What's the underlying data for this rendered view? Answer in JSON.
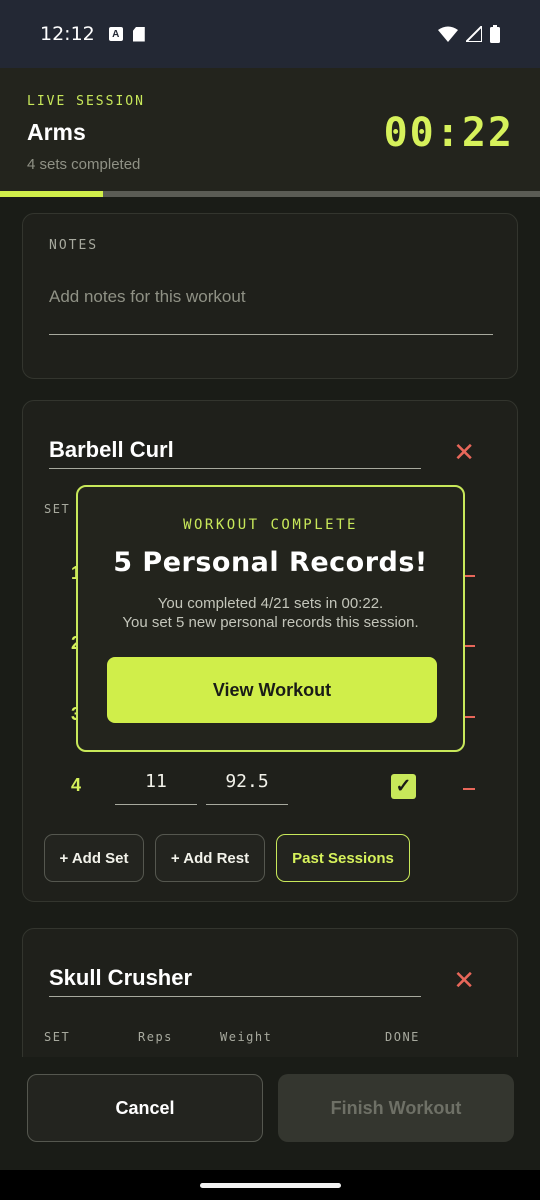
{
  "status_bar": {
    "time": "12:12",
    "icons": [
      "keyboard-a-icon",
      "sd-card-icon",
      "wifi-icon",
      "signal-icon",
      "battery-icon"
    ]
  },
  "header": {
    "live_label": "LIVE SESSION",
    "title": "Arms",
    "sets_completed": "4 sets completed",
    "timer": "00:22",
    "progress_fraction": 0.19
  },
  "notes": {
    "label": "NOTES",
    "placeholder": "Add notes for this workout"
  },
  "exercises": [
    {
      "name": "Barbell Curl",
      "columns": {
        "set": "SET"
      },
      "rows": [
        {
          "set": "1"
        },
        {
          "set": "2"
        },
        {
          "set": "3"
        },
        {
          "set": "4",
          "reps": "11",
          "weight": "92.5",
          "done": true
        }
      ],
      "buttons": {
        "add_set": "+ Add Set",
        "add_rest": "+ Add Rest",
        "past_sessions": "Past Sessions"
      }
    },
    {
      "name": "Skull Crusher",
      "columns": {
        "set": "SET",
        "reps": "Reps",
        "weight": "Weight",
        "done": "DONE"
      }
    }
  ],
  "modal": {
    "kicker": "WORKOUT COMPLETE",
    "title": "5 Personal Records!",
    "line1": "You completed 4/21 sets in 00:22.",
    "line2": "You set 5 new personal records this session.",
    "button": "View Workout"
  },
  "footer": {
    "cancel": "Cancel",
    "finish": "Finish Workout"
  },
  "colors": {
    "accent": "#d0ee4a",
    "danger": "#e8675a",
    "background": "#1a1c17"
  }
}
